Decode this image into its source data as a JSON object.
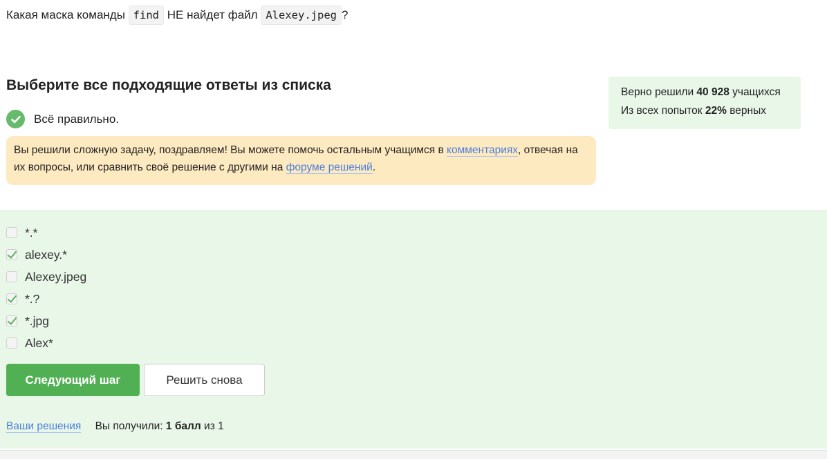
{
  "question": {
    "prefix": "Какая маска команды",
    "code_command": "find",
    "middle": "НЕ найдет файл",
    "code_file": "Alexey.jpeg",
    "suffix": "?"
  },
  "choose_heading": "Выберите все подходящие ответы из списка",
  "result": {
    "status_text": "Всё правильно.",
    "success_color": "#66bb6a",
    "icon": "check-circle-icon"
  },
  "notice": {
    "part1": "Вы решили сложную задачу, поздравляем! Вы можете помочь остальным учащимся в",
    "comments_link": "комментариях",
    "part2": ", отвечая на их вопросы, или сравнить своё решение с другими на",
    "forum_link": "форуме решений",
    "part3": "."
  },
  "stats": {
    "solved_label": "Верно решили",
    "solved_count": "40 928",
    "solved_suffix": "учащихся",
    "attempts_label": "Из всех попыток",
    "attempts_percent": "22%",
    "attempts_suffix": "верных"
  },
  "options": [
    {
      "label": "*.*",
      "checked": false
    },
    {
      "label": "alexey.*",
      "checked": true
    },
    {
      "label": "Alexey.jpeg",
      "checked": false
    },
    {
      "label": "*.?",
      "checked": true
    },
    {
      "label": "*.jpg",
      "checked": true
    },
    {
      "label": "Alex*",
      "checked": false
    }
  ],
  "buttons": {
    "next_label": "Следующий шаг",
    "retry_label": "Решить снова"
  },
  "footer": {
    "solutions_link": "Ваши решения",
    "score_prefix": "Вы получили:",
    "score_value": "1 балл",
    "score_suffix": "из 1"
  },
  "colors": {
    "accent_green": "#52b054",
    "section_bg": "#e9f7e9",
    "notice_bg": "#feeac1",
    "link": "#4c7fdb"
  }
}
